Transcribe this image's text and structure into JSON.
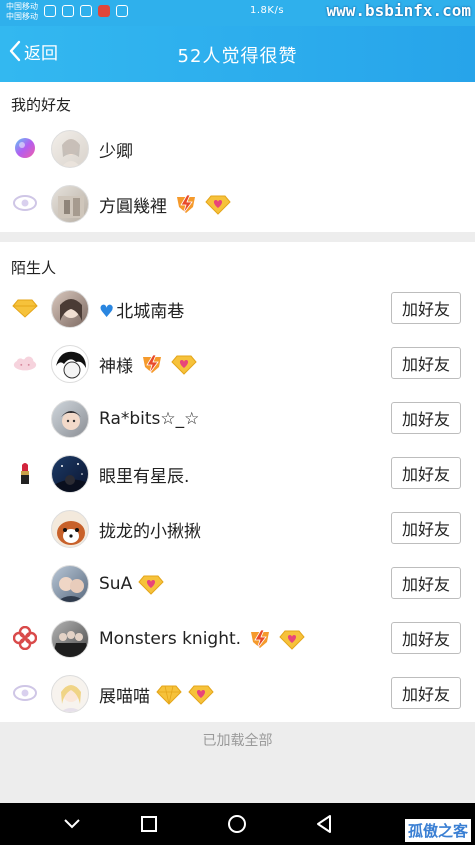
{
  "status_bar": {
    "carrier_line1": "中国移动",
    "carrier_line2": "中国移动",
    "speed": "1.8K/s",
    "watermark": "www.bsbinfx.com"
  },
  "header": {
    "back_label": "返回",
    "title": "52人觉得很赞"
  },
  "friends": {
    "title": "我的好友",
    "items": [
      {
        "name": "少卿"
      },
      {
        "name": "方圓幾裡"
      }
    ]
  },
  "strangers": {
    "title": "陌生人",
    "add_label": "加好友",
    "items": [
      {
        "name": "北城南巷"
      },
      {
        "name": "神様"
      },
      {
        "name": "Ra*bits☆_☆"
      },
      {
        "name": "眼里有星辰."
      },
      {
        "name": "拢龙的小揪揪"
      },
      {
        "name": "SuA"
      },
      {
        "name": "Monsters knight."
      },
      {
        "name": "展喵喵"
      }
    ]
  },
  "footer": {
    "loaded_text": "已加载全部"
  },
  "bottom_watermark": "孤傲之客",
  "colors": {
    "header": "#2fb0ec",
    "diamond": "#f6c23b",
    "heart": "#e8457a"
  }
}
